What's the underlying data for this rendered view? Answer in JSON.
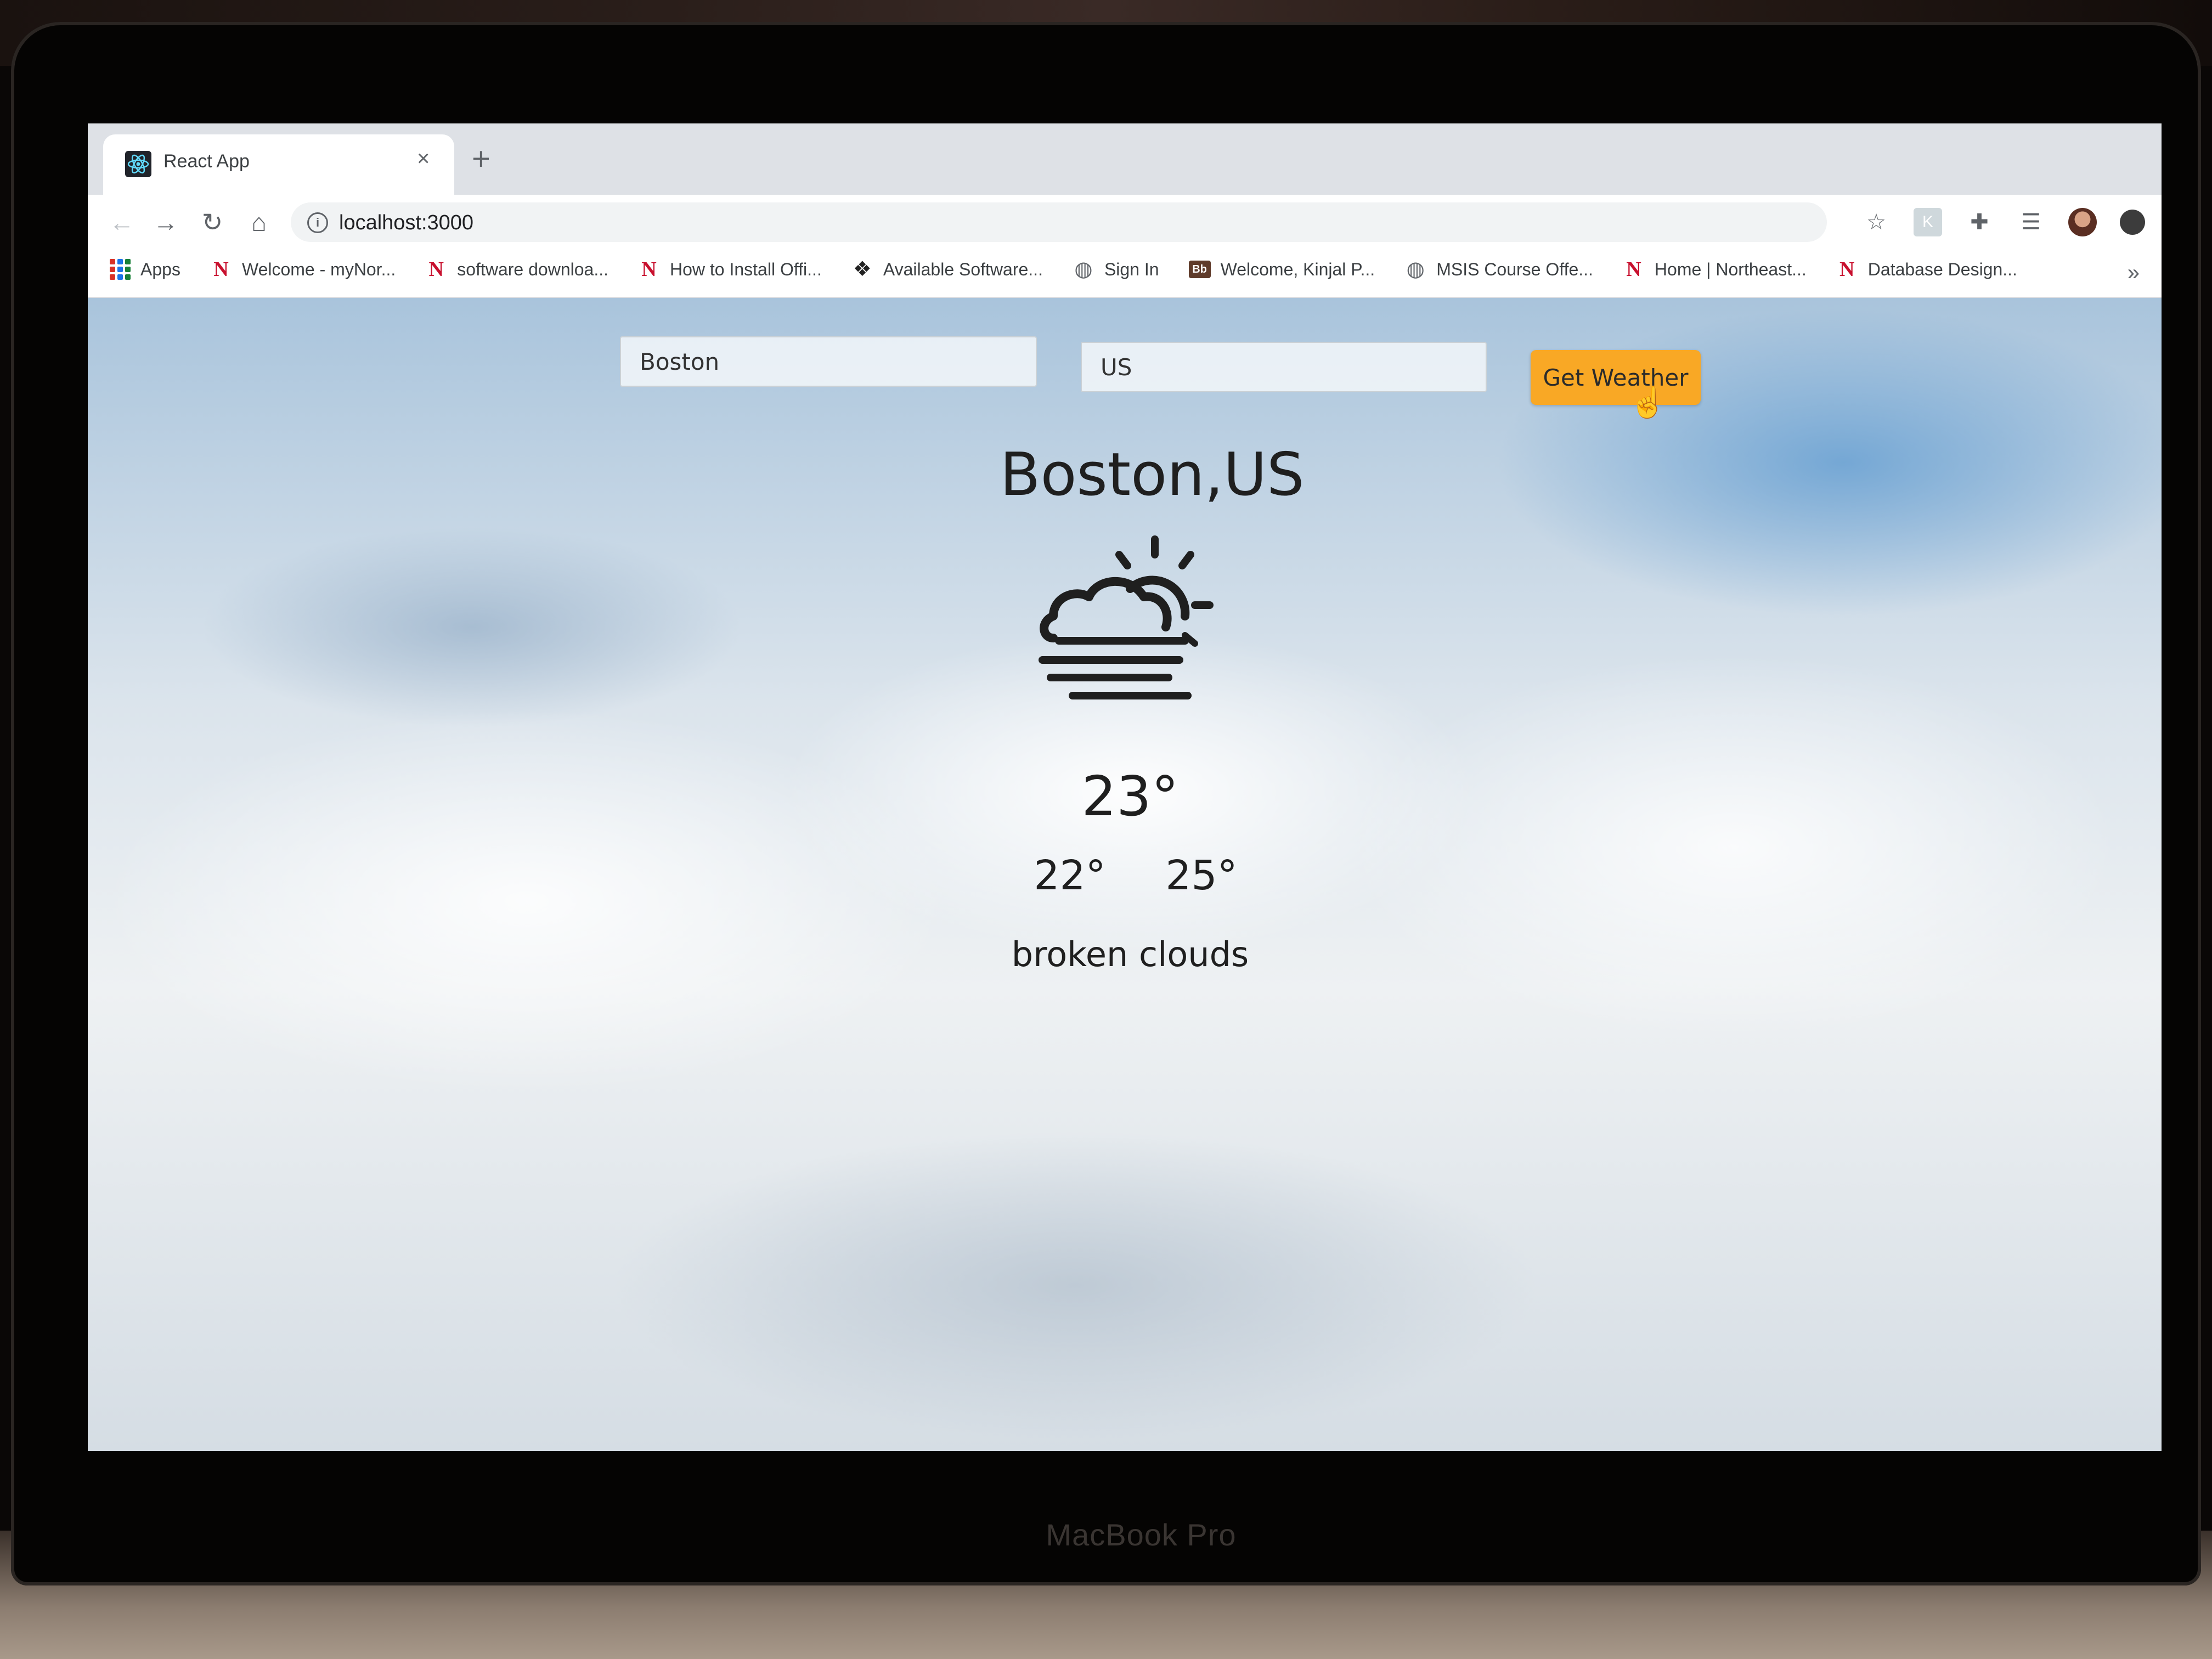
{
  "device": {
    "label": "MacBook Pro"
  },
  "browser": {
    "tab": {
      "title": "React App",
      "favicon": "react-icon",
      "close": "×"
    },
    "new_tab": "+",
    "nav": {
      "back": "←",
      "forward": "→",
      "reload": "↻",
      "home": "⌂"
    },
    "url": "localhost:3000",
    "bookmarks": [
      {
        "label": "Apps",
        "icon": "apps-grid-icon"
      },
      {
        "label": "Welcome - myNor...",
        "icon": "northeastern-icon"
      },
      {
        "label": "software downloa...",
        "icon": "northeastern-icon"
      },
      {
        "label": "How to Install Offi...",
        "icon": "northeastern-icon"
      },
      {
        "label": "Available Software...",
        "icon": "paw-icon"
      },
      {
        "label": "Sign In",
        "icon": "globe-icon"
      },
      {
        "label": "Welcome, Kinjal P...",
        "icon": "blackboard-icon"
      },
      {
        "label": "MSIS Course Offe...",
        "icon": "globe-icon"
      },
      {
        "label": "Home | Northeast...",
        "icon": "northeastern-icon"
      },
      {
        "label": "Database Design...",
        "icon": "northeastern-icon"
      }
    ],
    "more_bookmarks": "»"
  },
  "weather_form": {
    "city_value": "Boston",
    "country_value": "US",
    "button_label": "Get Weather",
    "button_color": "#f9a825"
  },
  "weather": {
    "location": "Boston,US",
    "icon": "partly-cloudy-fog-icon",
    "temperature": "23°",
    "min_temp": "22°",
    "max_temp": "25°",
    "description": "broken clouds"
  }
}
